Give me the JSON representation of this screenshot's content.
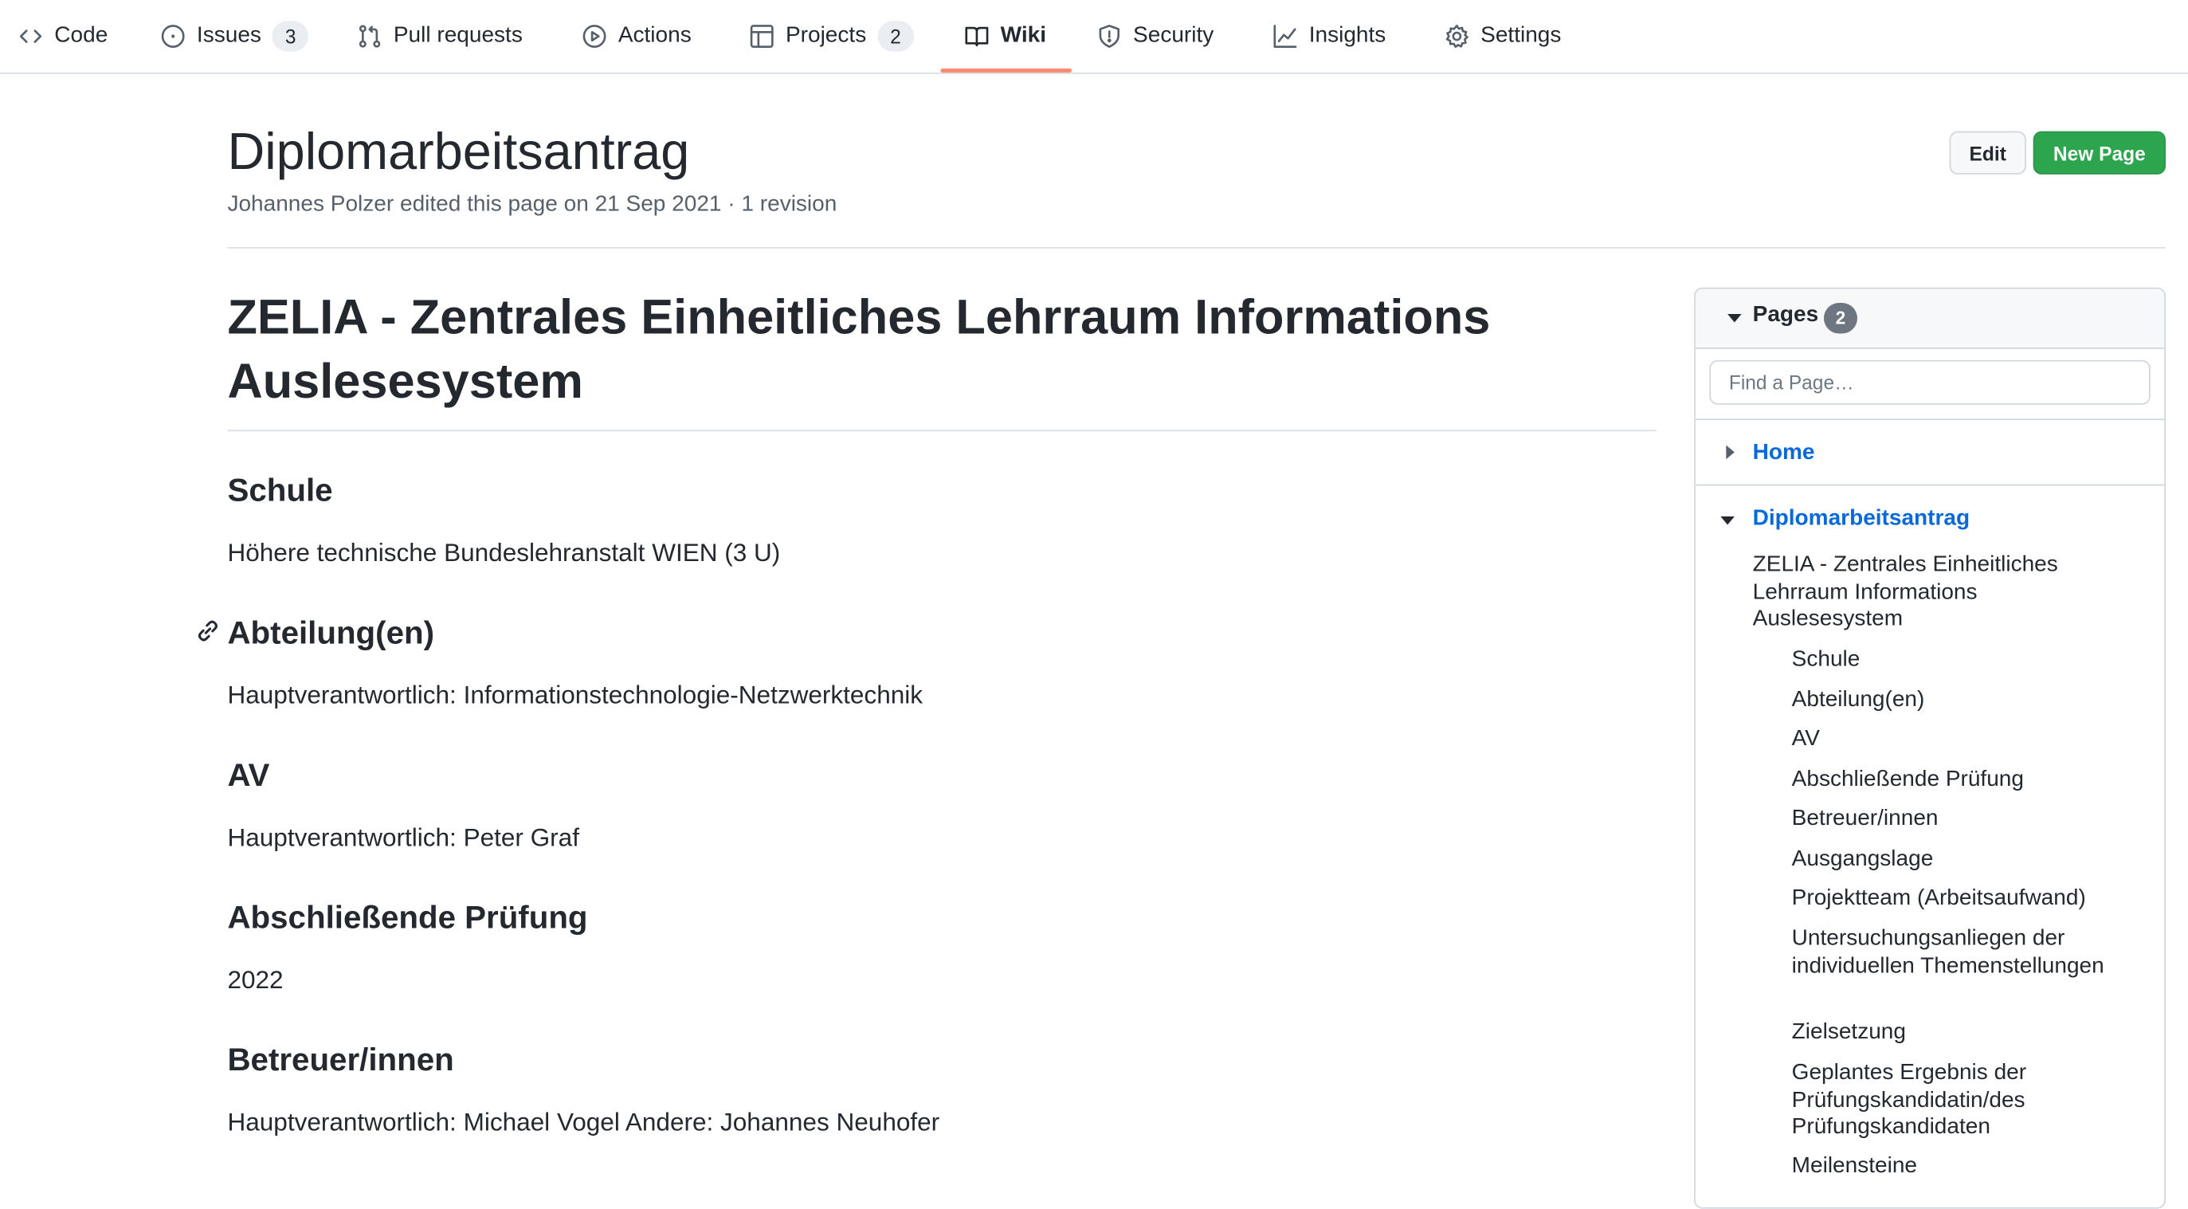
{
  "nav": {
    "tabs": [
      {
        "label": "Code",
        "icon": "code-icon"
      },
      {
        "label": "Issues",
        "icon": "issue-opened-icon",
        "count": "3"
      },
      {
        "label": "Pull requests",
        "icon": "git-pull-request-icon"
      },
      {
        "label": "Actions",
        "icon": "play-icon"
      },
      {
        "label": "Projects",
        "icon": "table-icon",
        "count": "2"
      },
      {
        "label": "Wiki",
        "icon": "book-icon",
        "selected": true
      },
      {
        "label": "Security",
        "icon": "shield-icon"
      },
      {
        "label": "Insights",
        "icon": "graph-icon"
      },
      {
        "label": "Settings",
        "icon": "gear-icon"
      }
    ],
    "selected_underline_color": "#fd8c73"
  },
  "header": {
    "title": "Diplomarbeitsantrag",
    "meta": "Johannes Polzer edited this page on 21 Sep 2021 · 1 revision",
    "edit_label": "Edit",
    "new_page_label": "New Page",
    "new_page_color": "#2da44e"
  },
  "content": {
    "h1": "ZELIA - Zentrales Einheitliches Lehrraum Informations Auslesesystem",
    "sections": [
      {
        "heading": "Schule",
        "text": "Höhere technische Bundeslehranstalt WIEN (3 U)"
      },
      {
        "heading": "Abteilung(en)",
        "text": "Hauptverantwortlich: Informationstechnologie-Netzwerktechnik"
      },
      {
        "heading": "AV",
        "text": "Hauptverantwortlich: Peter Graf"
      },
      {
        "heading": "Abschließende Prüfung",
        "text": "2022"
      },
      {
        "heading": "Betreuer/innen",
        "text": "Hauptverantwortlich: Michael Vogel Andere: Johannes Neuhofer"
      }
    ]
  },
  "sidebar": {
    "title": "Pages",
    "count": "2",
    "search_placeholder": "Find a Page…",
    "pages": [
      {
        "label": "Home"
      },
      {
        "label": "Diplomarbeitsantrag"
      }
    ],
    "toc_h1": "ZELIA - Zentrales Einheitliches Lehrraum Informations Auslesesystem",
    "toc": [
      "Schule",
      "Abteilung(en)",
      "AV",
      "Abschließende Prüfung",
      "Betreuer/innen",
      "Ausgangslage",
      "Projektteam (Arbeitsaufwand)",
      "Untersuchungsanliegen der individuellen Themenstellungen",
      "Zielsetzung",
      "Geplantes Ergebnis der Prüfungskandidatin/des Prüfungskandidaten",
      "Meilensteine"
    ]
  }
}
